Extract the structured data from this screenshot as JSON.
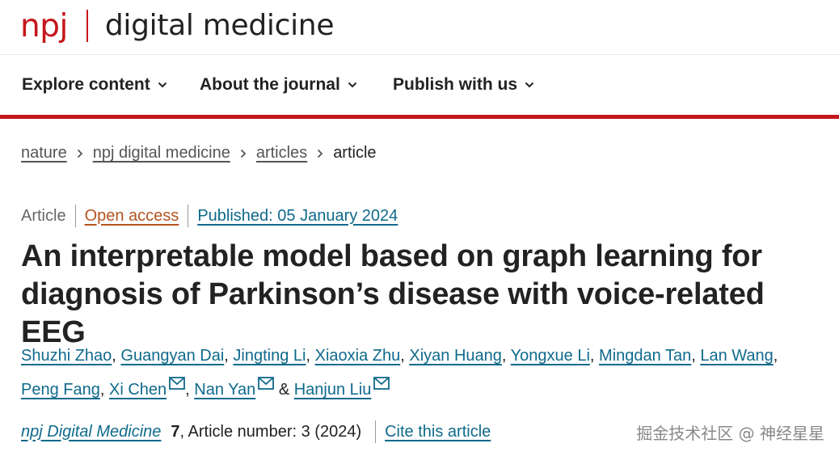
{
  "brand": {
    "npj": "npj",
    "title": "digital medicine",
    "color": "#c4161c"
  },
  "nav": {
    "items": [
      {
        "label": "Explore content"
      },
      {
        "label": "About the journal"
      },
      {
        "label": "Publish with us"
      }
    ]
  },
  "breadcrumb": {
    "items": [
      "nature",
      "npj digital medicine",
      "articles"
    ],
    "current": "article"
  },
  "meta": {
    "type": "Article",
    "open_access": "Open access",
    "published": "Published: 05 January 2024"
  },
  "title_line1": "An interpretable model based on graph learning for",
  "title_line2": "diagnosis of Parkinson’s disease with voice-related EEG",
  "authors": [
    "Shuzhi Zhao",
    "Guangyan Dai",
    "Jingting Li",
    "Xiaoxia Zhu",
    "Xiyan Huang",
    "Yongxue Li",
    "Mingdan Tan",
    "Lan Wang",
    "Peng Fang",
    "Xi Chen",
    "Nan Yan",
    "Hanjun Liu"
  ],
  "author_amp": "&",
  "journal": {
    "name": "npj Digital Medicine",
    "volume": "7",
    "article_number": ", Article number: 3 (2024)",
    "cite": "Cite this article"
  },
  "watermark": "掘金技术社区 @ 神经星星",
  "colors": {
    "link": "#0f6a8c",
    "open_access": "#b5541f",
    "rule": "#c4161c"
  }
}
